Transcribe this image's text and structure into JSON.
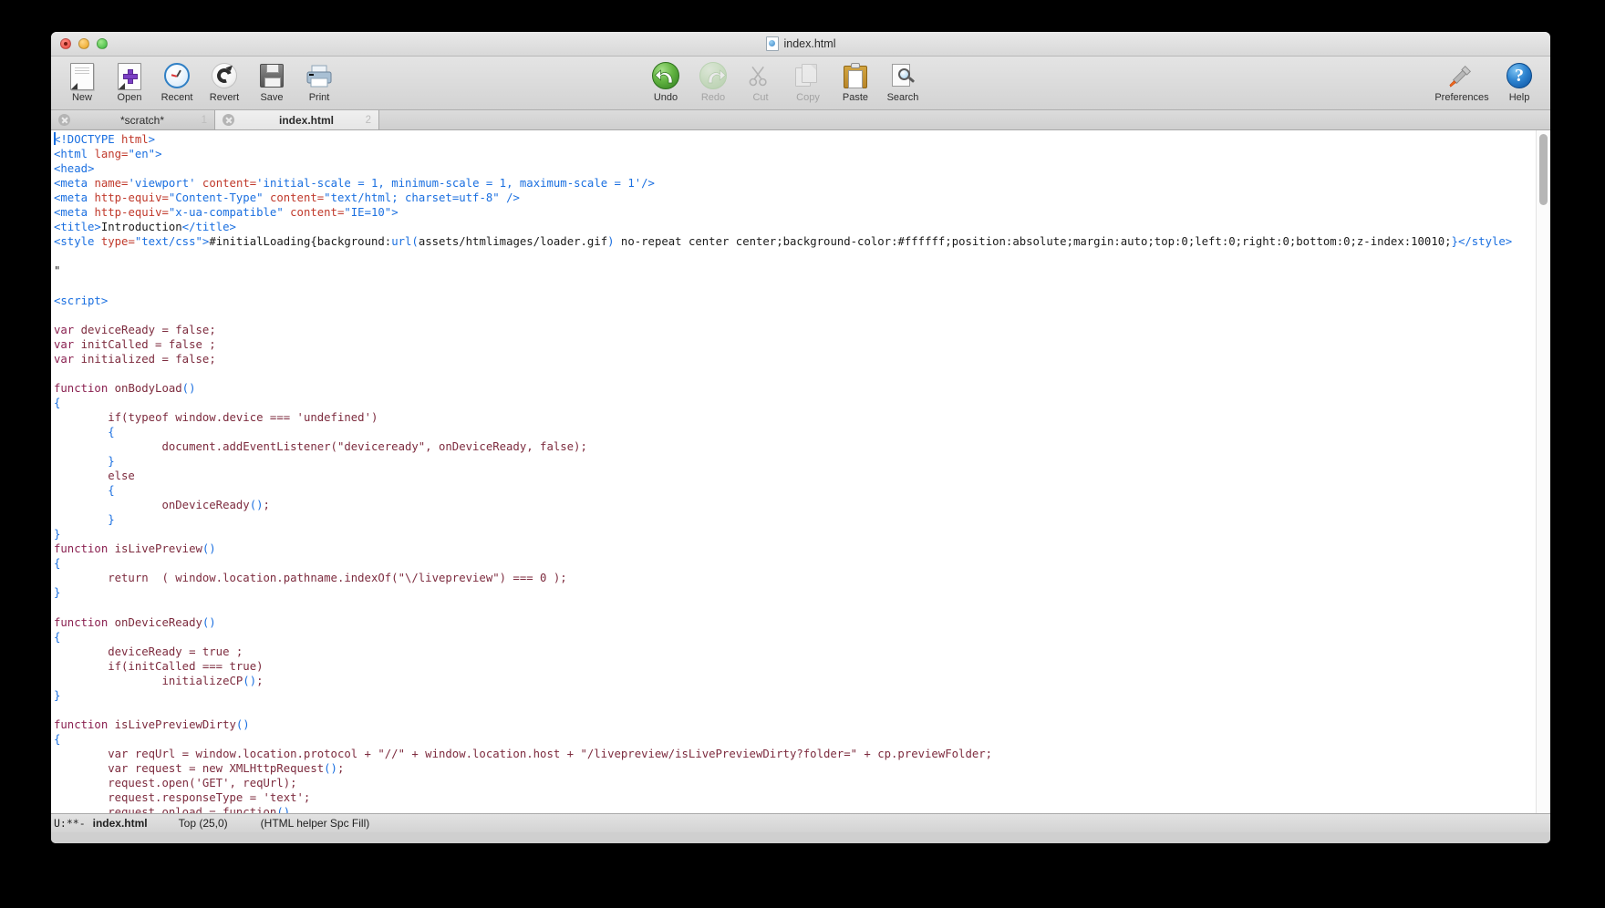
{
  "window": {
    "title": "index.html",
    "title_icon": "html-document-icon",
    "traffic_lights": [
      "close-button",
      "minimize-button",
      "zoom-button"
    ]
  },
  "toolbar": {
    "left_items": [
      {
        "label": "New",
        "icon": "new-document-icon",
        "enabled": true
      },
      {
        "label": "Open",
        "icon": "open-document-icon",
        "enabled": true
      },
      {
        "label": "Recent",
        "icon": "clock-icon",
        "enabled": true
      },
      {
        "label": "Revert",
        "icon": "revert-arrow-icon",
        "enabled": true
      },
      {
        "label": "Save",
        "icon": "floppy-disk-icon",
        "enabled": true
      },
      {
        "label": "Print",
        "icon": "printer-icon",
        "enabled": true
      }
    ],
    "middle_items": [
      {
        "label": "Undo",
        "icon": "undo-arrow-icon",
        "enabled": true
      },
      {
        "label": "Redo",
        "icon": "redo-arrow-icon",
        "enabled": false
      },
      {
        "label": "Cut",
        "icon": "scissors-icon",
        "enabled": false
      },
      {
        "label": "Copy",
        "icon": "copy-pages-icon",
        "enabled": false
      },
      {
        "label": "Paste",
        "icon": "clipboard-icon",
        "enabled": true
      },
      {
        "label": "Search",
        "icon": "magnifier-page-icon",
        "enabled": true
      }
    ],
    "right_items": [
      {
        "label": "Preferences",
        "icon": "screwdriver-icon",
        "enabled": true
      },
      {
        "label": "Help",
        "icon": "help-circle-icon",
        "enabled": true
      }
    ]
  },
  "tabs": [
    {
      "label": "*scratch*",
      "number": "1",
      "active": false,
      "close_icon": "close-circle-icon"
    },
    {
      "label": "index.html",
      "number": "2",
      "active": true,
      "close_icon": "close-circle-icon"
    }
  ],
  "statusbar": {
    "mode_flags": "U:**-",
    "filename": "index.html",
    "position": "Top (25,0)",
    "major_mode": "(HTML helper Spc Fill)"
  },
  "scrollbar": {
    "orientation": "vertical",
    "thumb_position": "top"
  },
  "editor": {
    "lines": [
      {
        "n": 1,
        "segments": [
          {
            "t": "<",
            "c": "tag"
          },
          {
            "t": "!DOCTYPE",
            "c": "tag"
          },
          {
            "t": " ",
            "c": "txt"
          },
          {
            "t": "html",
            "c": "attr"
          },
          {
            "t": ">",
            "c": "tag"
          }
        ]
      },
      {
        "n": 2,
        "segments": [
          {
            "t": "<html",
            "c": "tag"
          },
          {
            "t": " ",
            "c": "txt"
          },
          {
            "t": "lang=",
            "c": "attr"
          },
          {
            "t": "\"en\"",
            "c": "attrv"
          },
          {
            "t": ">",
            "c": "tag"
          }
        ]
      },
      {
        "n": 3,
        "segments": [
          {
            "t": "<head>",
            "c": "tag"
          }
        ]
      },
      {
        "n": 4,
        "segments": [
          {
            "t": "<meta",
            "c": "tag"
          },
          {
            "t": " ",
            "c": "txt"
          },
          {
            "t": "name=",
            "c": "attr"
          },
          {
            "t": "'viewport'",
            "c": "attrv"
          },
          {
            "t": " ",
            "c": "txt"
          },
          {
            "t": "content=",
            "c": "attr"
          },
          {
            "t": "'initial-scale = 1, minimum-scale = 1, maximum-scale = 1'",
            "c": "attrv"
          },
          {
            "t": "/>",
            "c": "tag"
          }
        ]
      },
      {
        "n": 5,
        "segments": [
          {
            "t": "<meta",
            "c": "tag"
          },
          {
            "t": " ",
            "c": "txt"
          },
          {
            "t": "http-equiv=",
            "c": "attr"
          },
          {
            "t": "\"Content-Type\"",
            "c": "attrv"
          },
          {
            "t": " ",
            "c": "txt"
          },
          {
            "t": "content=",
            "c": "attr"
          },
          {
            "t": "\"text/html; charset=utf-8\"",
            "c": "attrv"
          },
          {
            "t": " />",
            "c": "tag"
          }
        ]
      },
      {
        "n": 6,
        "segments": [
          {
            "t": "<meta",
            "c": "tag"
          },
          {
            "t": " ",
            "c": "txt"
          },
          {
            "t": "http-equiv=",
            "c": "attr"
          },
          {
            "t": "\"x-ua-compatible\"",
            "c": "attrv"
          },
          {
            "t": " ",
            "c": "txt"
          },
          {
            "t": "content=",
            "c": "attr"
          },
          {
            "t": "\"IE=10\"",
            "c": "attrv"
          },
          {
            "t": ">",
            "c": "tag"
          }
        ]
      },
      {
        "n": 7,
        "segments": [
          {
            "t": "<title>",
            "c": "tag"
          },
          {
            "t": "Introduction",
            "c": "txt"
          },
          {
            "t": "</title>",
            "c": "tag"
          }
        ]
      },
      {
        "n": 8,
        "segments": [
          {
            "t": "<style",
            "c": "tag"
          },
          {
            "t": " ",
            "c": "txt"
          },
          {
            "t": "type=",
            "c": "attr"
          },
          {
            "t": "\"text/css\"",
            "c": "attrv"
          },
          {
            "t": ">",
            "c": "tag"
          },
          {
            "t": "#initialLoading{background:",
            "c": "css"
          },
          {
            "t": "url(",
            "c": "br"
          },
          {
            "t": "assets/htmlimages/loader.gif",
            "c": "css"
          },
          {
            "t": ")",
            "c": "br"
          },
          {
            "t": " no-repeat center center;background-color:#ffffff;position:absolute;margin:auto;top:0;left:0;right:0;bottom:0;z-index:10010;",
            "c": "css"
          },
          {
            "t": "}",
            "c": "br"
          },
          {
            "t": "</style>",
            "c": "tag"
          }
        ]
      },
      {
        "n": 9,
        "segments": []
      },
      {
        "n": 10,
        "segments": [
          {
            "t": "\"",
            "c": "quote"
          }
        ]
      },
      {
        "n": 11,
        "segments": []
      },
      {
        "n": 12,
        "segments": [
          {
            "t": "<script>",
            "c": "tag"
          }
        ]
      },
      {
        "n": 13,
        "segments": []
      },
      {
        "n": 14,
        "segments": [
          {
            "t": "var",
            "c": "kw"
          },
          {
            "t": " deviceReady = ",
            "c": "body"
          },
          {
            "t": "false",
            "c": "body"
          },
          {
            "t": ";",
            "c": "body"
          }
        ]
      },
      {
        "n": 15,
        "segments": [
          {
            "t": "var",
            "c": "kw"
          },
          {
            "t": " initCalled = ",
            "c": "body"
          },
          {
            "t": "false",
            "c": "body"
          },
          {
            "t": " ;",
            "c": "body"
          }
        ]
      },
      {
        "n": 16,
        "segments": [
          {
            "t": "var",
            "c": "kw"
          },
          {
            "t": " initialized = ",
            "c": "body"
          },
          {
            "t": "false",
            "c": "body"
          },
          {
            "t": ";",
            "c": "body"
          }
        ]
      },
      {
        "n": 17,
        "segments": []
      },
      {
        "n": 18,
        "segments": [
          {
            "t": "function",
            "c": "kw"
          },
          {
            "t": " onBodyLoad",
            "c": "body"
          },
          {
            "t": "()",
            "c": "br"
          }
        ]
      },
      {
        "n": 19,
        "segments": [
          {
            "t": "{",
            "c": "br"
          }
        ]
      },
      {
        "n": 20,
        "segments": [
          {
            "t": "        if",
            "c": "body"
          },
          {
            "t": "(",
            "c": "body"
          },
          {
            "t": "typeof window.device === 'undefined'",
            "c": "body"
          },
          {
            "t": ")",
            "c": "body"
          }
        ]
      },
      {
        "n": 21,
        "segments": [
          {
            "t": "        ",
            "c": "body"
          },
          {
            "t": "{",
            "c": "br"
          }
        ]
      },
      {
        "n": 22,
        "segments": [
          {
            "t": "                document.addEventListener(\"deviceready\", onDeviceReady, false);",
            "c": "body"
          }
        ]
      },
      {
        "n": 23,
        "segments": [
          {
            "t": "        ",
            "c": "body"
          },
          {
            "t": "}",
            "c": "br"
          }
        ]
      },
      {
        "n": 24,
        "segments": [
          {
            "t": "        else",
            "c": "body"
          }
        ]
      },
      {
        "n": 25,
        "segments": [
          {
            "t": "        ",
            "c": "body"
          },
          {
            "t": "{",
            "c": "br"
          }
        ]
      },
      {
        "n": 26,
        "segments": [
          {
            "t": "                onDeviceReady",
            "c": "body"
          },
          {
            "t": "()",
            "c": "br"
          },
          {
            "t": ";",
            "c": "body"
          }
        ]
      },
      {
        "n": 27,
        "segments": [
          {
            "t": "        ",
            "c": "body"
          },
          {
            "t": "}",
            "c": "br"
          }
        ]
      },
      {
        "n": 28,
        "segments": [
          {
            "t": "}",
            "c": "br"
          }
        ]
      },
      {
        "n": 29,
        "segments": [
          {
            "t": "function",
            "c": "kw"
          },
          {
            "t": " isLivePreview",
            "c": "body"
          },
          {
            "t": "()",
            "c": "br"
          }
        ]
      },
      {
        "n": 30,
        "segments": [
          {
            "t": "{",
            "c": "br"
          }
        ]
      },
      {
        "n": 31,
        "segments": [
          {
            "t": "        return  ( window.location.pathname.indexOf(\"\\/livepreview\") === 0 );",
            "c": "body"
          }
        ]
      },
      {
        "n": 32,
        "segments": [
          {
            "t": "}",
            "c": "br"
          }
        ]
      },
      {
        "n": 33,
        "segments": []
      },
      {
        "n": 34,
        "segments": [
          {
            "t": "function",
            "c": "kw"
          },
          {
            "t": " onDeviceReady",
            "c": "body"
          },
          {
            "t": "()",
            "c": "br"
          }
        ]
      },
      {
        "n": 35,
        "segments": [
          {
            "t": "{",
            "c": "br"
          }
        ]
      },
      {
        "n": 36,
        "segments": [
          {
            "t": "        deviceReady = true ;",
            "c": "body"
          }
        ]
      },
      {
        "n": 37,
        "segments": [
          {
            "t": "        if(initCalled === true)",
            "c": "body"
          }
        ]
      },
      {
        "n": 38,
        "segments": [
          {
            "t": "                initializeCP",
            "c": "body"
          },
          {
            "t": "()",
            "c": "br"
          },
          {
            "t": ";",
            "c": "body"
          }
        ]
      },
      {
        "n": 39,
        "segments": [
          {
            "t": "}",
            "c": "br"
          }
        ]
      },
      {
        "n": 40,
        "segments": []
      },
      {
        "n": 41,
        "segments": [
          {
            "t": "function",
            "c": "kw"
          },
          {
            "t": " isLivePreviewDirty",
            "c": "body"
          },
          {
            "t": "()",
            "c": "br"
          }
        ]
      },
      {
        "n": 42,
        "segments": [
          {
            "t": "{",
            "c": "br"
          }
        ]
      },
      {
        "n": 43,
        "segments": [
          {
            "t": "        var reqUrl = window.location.protocol + \"//\" + window.location.host + \"/livepreview/isLivePreviewDirty?folder=\" + cp.previewFolder;",
            "c": "body"
          }
        ]
      },
      {
        "n": 44,
        "segments": [
          {
            "t": "        var request = new XMLHttpRequest",
            "c": "body"
          },
          {
            "t": "()",
            "c": "br"
          },
          {
            "t": ";",
            "c": "body"
          }
        ]
      },
      {
        "n": 45,
        "segments": [
          {
            "t": "        request.open('GET', reqUrl);",
            "c": "body"
          }
        ]
      },
      {
        "n": 46,
        "segments": [
          {
            "t": "        request.responseType = 'text';",
            "c": "body"
          }
        ]
      },
      {
        "n": 47,
        "segments": [
          {
            "t": "        request.onload = function",
            "c": "body"
          },
          {
            "t": "()",
            "c": "br"
          }
        ]
      }
    ]
  }
}
